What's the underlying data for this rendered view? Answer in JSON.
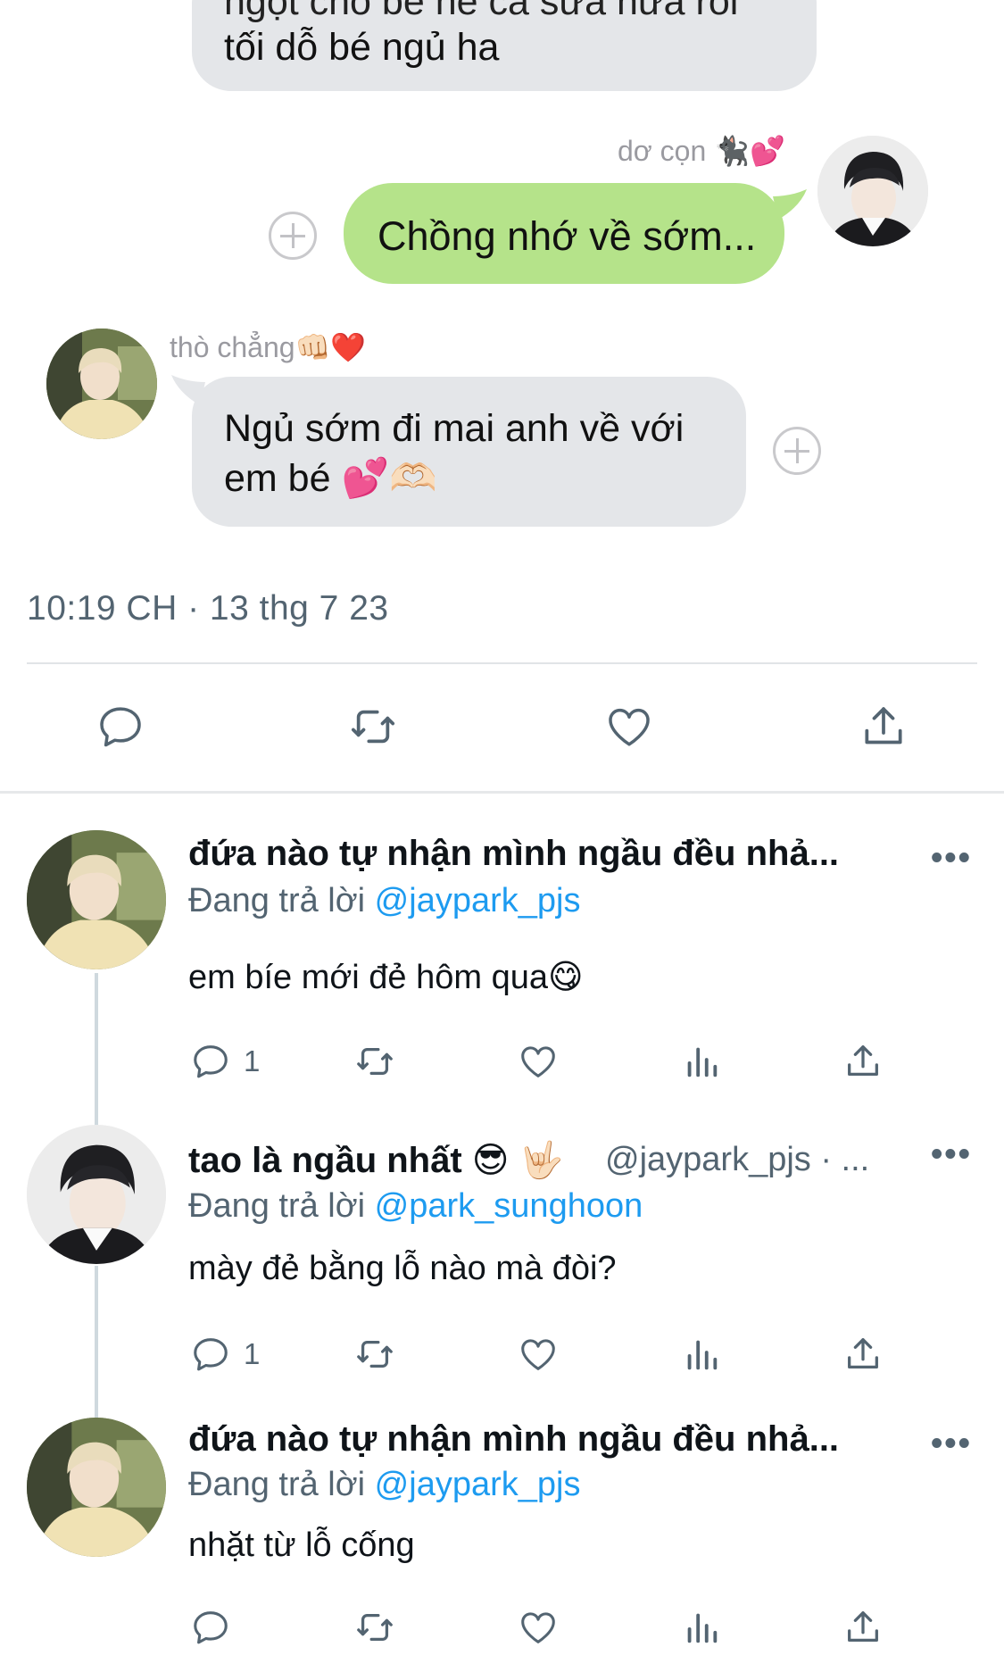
{
  "chat": {
    "top_bubble": {
      "line1": "ngọt cho bé nè cả sữa nữa rồi",
      "line2": "tối dỗ bé ngủ ha"
    },
    "sender_name": "dơ cọn 🐈‍⬛💕",
    "sent_message": "Chồng nhớ về sớm...",
    "receiver_name": "thò chẳng👊🏻❤️",
    "received_line1": "Ngủ sớm đi mai anh về với",
    "received_line2": "em bé 💕🫶🏻"
  },
  "tweet": {
    "timestamp": "10:19 CH · 13 thg 7 23"
  },
  "replies": [
    {
      "name": "đứa nào tự nhận mình ngầu đều nhả...",
      "handle": "",
      "replying_prefix": "Đang trả lời",
      "replying_to": "@jaypark_pjs",
      "text": "em bíe mới đẻ hôm qua😋",
      "reply_count": "1",
      "avatar": "blonde"
    },
    {
      "name": "tao là ngầu nhất 😎 🤟🏻",
      "handle": "@jaypark_pjs · ...",
      "replying_prefix": "Đang trả lời",
      "replying_to": "@park_sunghoon",
      "text": "mày đẻ bằng lỗ nào mà đòi?",
      "reply_count": "1",
      "avatar": "dark"
    },
    {
      "name": "đứa nào tự nhận mình ngầu đều nhả...",
      "handle": "",
      "replying_prefix": "Đang trả lời",
      "replying_to": "@jaypark_pjs",
      "text": "nhặt từ lỗ cống",
      "reply_count": "",
      "avatar": "blonde"
    }
  ],
  "more_label": "•••",
  "icons": [
    "reply-icon",
    "retweet-icon",
    "like-icon",
    "share-icon",
    "analytics-icon",
    "add-icon"
  ],
  "colors": {
    "accent": "#1d9bf0",
    "bubble_green": "#b5e38a",
    "bubble_gray": "#e4e6e9",
    "muted": "#536471"
  }
}
